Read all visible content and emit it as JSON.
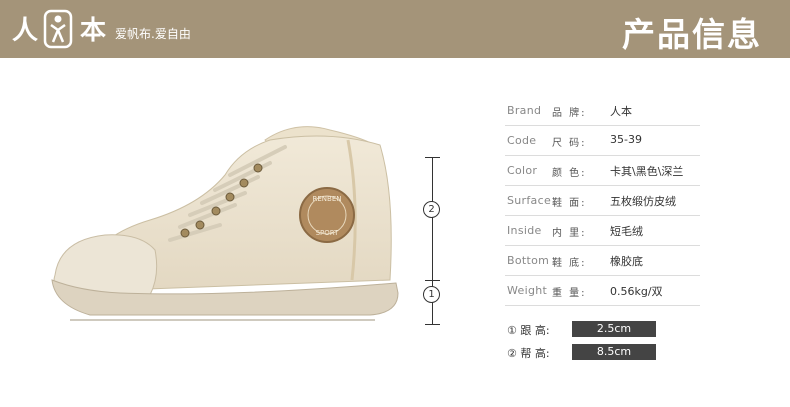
{
  "brand": {
    "logo_left": "人",
    "logo_right": "本",
    "slogan": "爱帆布.爱自由",
    "banner_color": "#a49479"
  },
  "header": {
    "title": "产品信息"
  },
  "dimension_markers": {
    "marker1": "1",
    "marker2": "2"
  },
  "badge": {
    "top_text": "RENBEN",
    "bottom_text": "SPORT"
  },
  "specs": [
    {
      "en": "Brand",
      "cn": "品 牌:",
      "value": "人本"
    },
    {
      "en": "Code",
      "cn": "尺 码:",
      "value": "35-39"
    },
    {
      "en": "Color",
      "cn": "颜 色:",
      "value": "卡其\\黑色\\深兰"
    },
    {
      "en": "Surface",
      "cn": "鞋 面:",
      "value": "五枚缎仿皮绒"
    },
    {
      "en": "Inside",
      "cn": "内 里:",
      "value": "短毛绒"
    },
    {
      "en": "Bottom",
      "cn": "鞋 底:",
      "value": "橡胶底"
    },
    {
      "en": "Weight",
      "cn": "重 量:",
      "value": "0.56kg/双"
    }
  ],
  "sizes": [
    {
      "label": "① 跟  高:",
      "value": "2.5cm"
    },
    {
      "label": "② 帮  高:",
      "value": "8.5cm"
    }
  ]
}
